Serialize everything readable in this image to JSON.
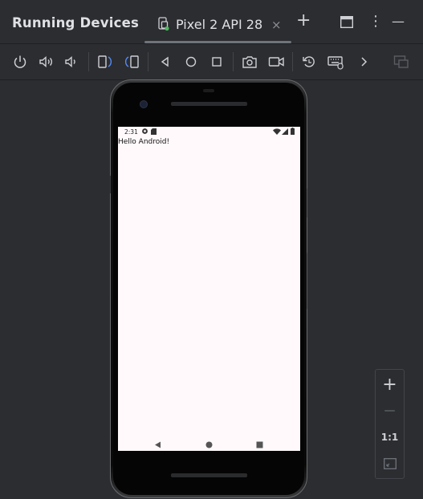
{
  "panel": {
    "title": "Running Devices"
  },
  "tab": {
    "label": "Pixel 2 API 28",
    "close": "×"
  },
  "window_controls": {
    "add": "+",
    "more": "⋮",
    "minimize": "—"
  },
  "device": {
    "status_time": "2:31",
    "content_text": "Hello Android!"
  },
  "zoom": {
    "zoom_in": "+",
    "zoom_out": "—",
    "actual_size": "1:1"
  },
  "colors": {
    "background": "#2b2d30",
    "screen": "#fff9fc",
    "accent": "#4dbb5f",
    "blue_icon": "#548af7"
  },
  "icons": [
    "power-icon",
    "volume-up-icon",
    "volume-down-icon",
    "rotate-left-icon",
    "rotate-right-icon",
    "back-icon",
    "home-icon",
    "overview-icon",
    "screenshot-icon",
    "screen-record-icon",
    "reset-icon",
    "keyboard-icon",
    "more-chevron-icon",
    "device-mirror-icon",
    "fit-screen-icon"
  ]
}
